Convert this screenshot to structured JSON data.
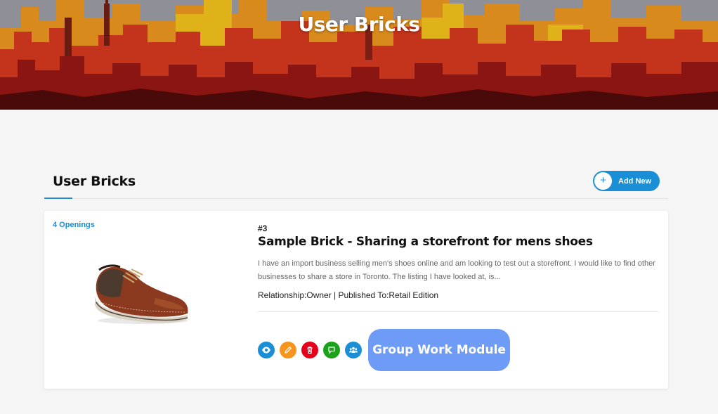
{
  "hero": {
    "title": "User Bricks"
  },
  "section": {
    "title": "User Bricks",
    "add_new_label": "Add New",
    "add_new_icon": "+"
  },
  "brick": {
    "openings": "4 Openings",
    "number": "#3",
    "title": "Sample Brick - Sharing a storefront for mens shoes",
    "description": "I have an import business selling men's shoes online and am looking to test out a storefront. I would like to find other businesses to share a store in Toronto. The listing I have looked at, is...",
    "meta": "Relationship:Owner | Published To:Retail Edition",
    "image": "brown-leather-shoe"
  },
  "actions": [
    {
      "icon": "eye-icon",
      "color": "#1a8fd6"
    },
    {
      "icon": "pencil-icon",
      "color": "#f7941d"
    },
    {
      "icon": "trash-icon",
      "color": "#e3001b"
    },
    {
      "icon": "chat-icon",
      "color": "#1ba11b"
    },
    {
      "icon": "users-icon",
      "color": "#1a8fd6"
    }
  ],
  "group_work": {
    "label": "Group Work Module",
    "color": "#6e9bf5"
  },
  "colors": {
    "accent": "#1a8fd6",
    "page_bg": "#f5f5f5"
  }
}
